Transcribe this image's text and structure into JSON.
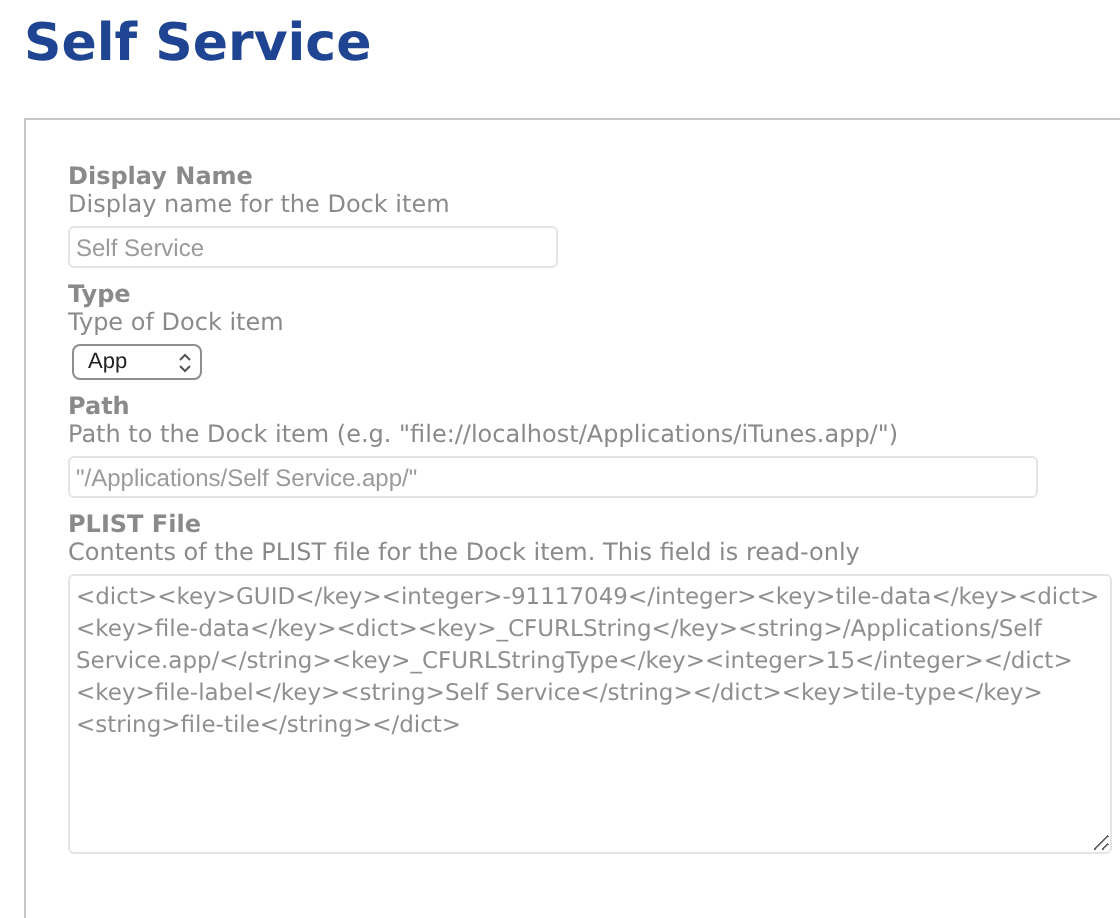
{
  "title": "Self Service",
  "fields": [
    {
      "kind": "text",
      "label": "Display Name",
      "description": "Display name for the Dock item",
      "value": "Self Service"
    },
    {
      "kind": "select",
      "label": "Type",
      "description": "Type of Dock item",
      "value": "App"
    },
    {
      "kind": "path",
      "label": "Path",
      "description": "Path to the Dock item (e.g. \"file://localhost/Applications/iTunes.app/\")",
      "value": "\"/Applications/Self Service.app/\""
    },
    {
      "kind": "textarea",
      "label": "PLIST File",
      "description": "Contents of the PLIST file for the Dock item. This field is read-only",
      "value": "<dict><key>GUID</key><integer>-91117049</integer><key>tile-data</key><dict><key>file-data</key><dict><key>_CFURLString</key><string>/Applications/Self Service.app/</string><key>_CFURLStringType</key><integer>15</integer></dict><key>file-label</key><string>Self Service</string></dict><key>tile-type</key><string>file-tile</string></dict>"
    }
  ]
}
